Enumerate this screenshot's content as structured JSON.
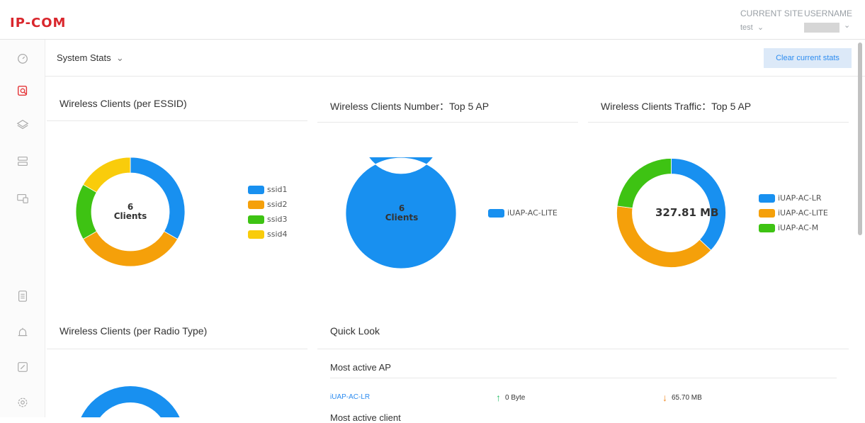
{
  "header": {
    "logo": "IP-COM",
    "current_site_label": "CURRENT SITE",
    "current_site_value": "test",
    "username_label": "USERNAME"
  },
  "toolbar": {
    "page_title": "System Stats",
    "clear_button": "Clear current stats"
  },
  "sidebar": {
    "icons": [
      "dashboard-icon",
      "stats-icon",
      "layers-icon",
      "devices-icon",
      "ap-icon",
      "logs-icon",
      "alarm-icon",
      "edit-icon",
      "settings-icon"
    ]
  },
  "panels": {
    "essid": {
      "title": "Wireless Clients (per ESSID)",
      "center_value": "6",
      "center_label": "Clients",
      "legend": [
        {
          "name": "ssid1",
          "color": "#1890f0"
        },
        {
          "name": "ssid2",
          "color": "#f5a00a"
        },
        {
          "name": "ssid3",
          "color": "#3ec313"
        },
        {
          "name": "ssid4",
          "color": "#f9cc0b"
        }
      ]
    },
    "top5_number": {
      "title": "Wireless Clients Number：Top 5 AP",
      "center_value": "6",
      "center_label": "Clients",
      "legend": [
        {
          "name": "iUAP-AC-LITE",
          "color": "#1890f0"
        }
      ]
    },
    "top5_traffic": {
      "title": "Wireless Clients Traffic：Top 5 AP",
      "center_value": "327.81 MB",
      "legend": [
        {
          "name": "iUAP-AC-LR",
          "color": "#1890f0"
        },
        {
          "name": "iUAP-AC-LITE",
          "color": "#f5a00a"
        },
        {
          "name": "iUAP-AC-M",
          "color": "#3ec313"
        }
      ]
    },
    "radio_type": {
      "title": "Wireless Clients (per Radio Type)"
    },
    "quick_look": {
      "title": "Quick Look",
      "most_active_ap_label": "Most active AP",
      "ap_name": "iUAP-AC-LR",
      "upload": "0 Byte",
      "download": "65.70 MB",
      "most_active_client_label": "Most active client"
    }
  },
  "chart_data": [
    {
      "type": "pie",
      "title": "Wireless Clients (per ESSID)",
      "categories": [
        "ssid1",
        "ssid2",
        "ssid3",
        "ssid4"
      ],
      "values": [
        2,
        2,
        1,
        1
      ]
    },
    {
      "type": "pie",
      "title": "Wireless Clients Number：Top 5 AP",
      "categories": [
        "iUAP-AC-LITE"
      ],
      "values": [
        6
      ]
    },
    {
      "type": "pie",
      "title": "Wireless Clients Traffic：Top 5 AP",
      "categories": [
        "iUAP-AC-LR",
        "iUAP-AC-LITE",
        "iUAP-AC-M"
      ],
      "values": [
        0.37,
        0.4,
        0.23
      ]
    }
  ]
}
